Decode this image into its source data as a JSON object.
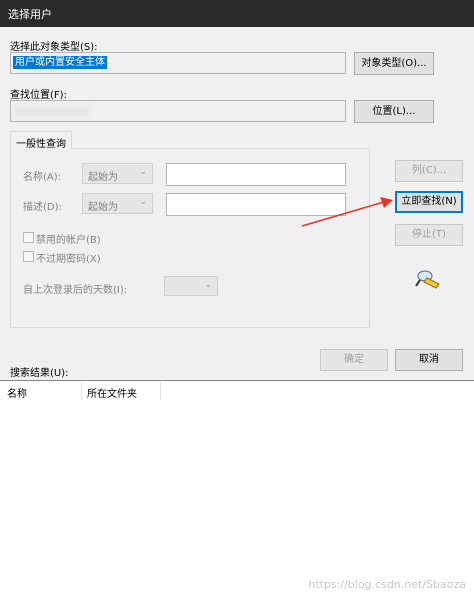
{
  "window": {
    "title": "选择用户"
  },
  "object_type": {
    "label": "选择此对象类型(S):",
    "value": "用户或内置安全主体",
    "button": "对象类型(O)..."
  },
  "location": {
    "label": "查找位置(F):",
    "button": "位置(L)..."
  },
  "tab": {
    "label": "一般性查询"
  },
  "query": {
    "name_label": "名称(A):",
    "name_mode": "起始为",
    "desc_label": "描述(D):",
    "desc_mode": "起始为",
    "disabled_accounts": "禁用的帐户(B)",
    "non_expiring_password": "不过期密码(X)",
    "days_since_logon_label": "自上次登录后的天数(I):"
  },
  "side_buttons": {
    "columns": "列(C)...",
    "find_now": "立即查找(N)",
    "stop": "停止(T)"
  },
  "dialog_buttons": {
    "ok": "确定",
    "cancel": "取消"
  },
  "results": {
    "label": "搜索结果(U):",
    "columns": [
      "名称",
      "所在文件夹"
    ]
  },
  "watermark": "https://blog.csdn.net/Sbaoza",
  "colors": {
    "selection": "#0078d7",
    "arrow": "#e8352b",
    "titlebar": "#2a2a2a"
  },
  "icons": {
    "search_icon": "flashlight-search-icon"
  }
}
